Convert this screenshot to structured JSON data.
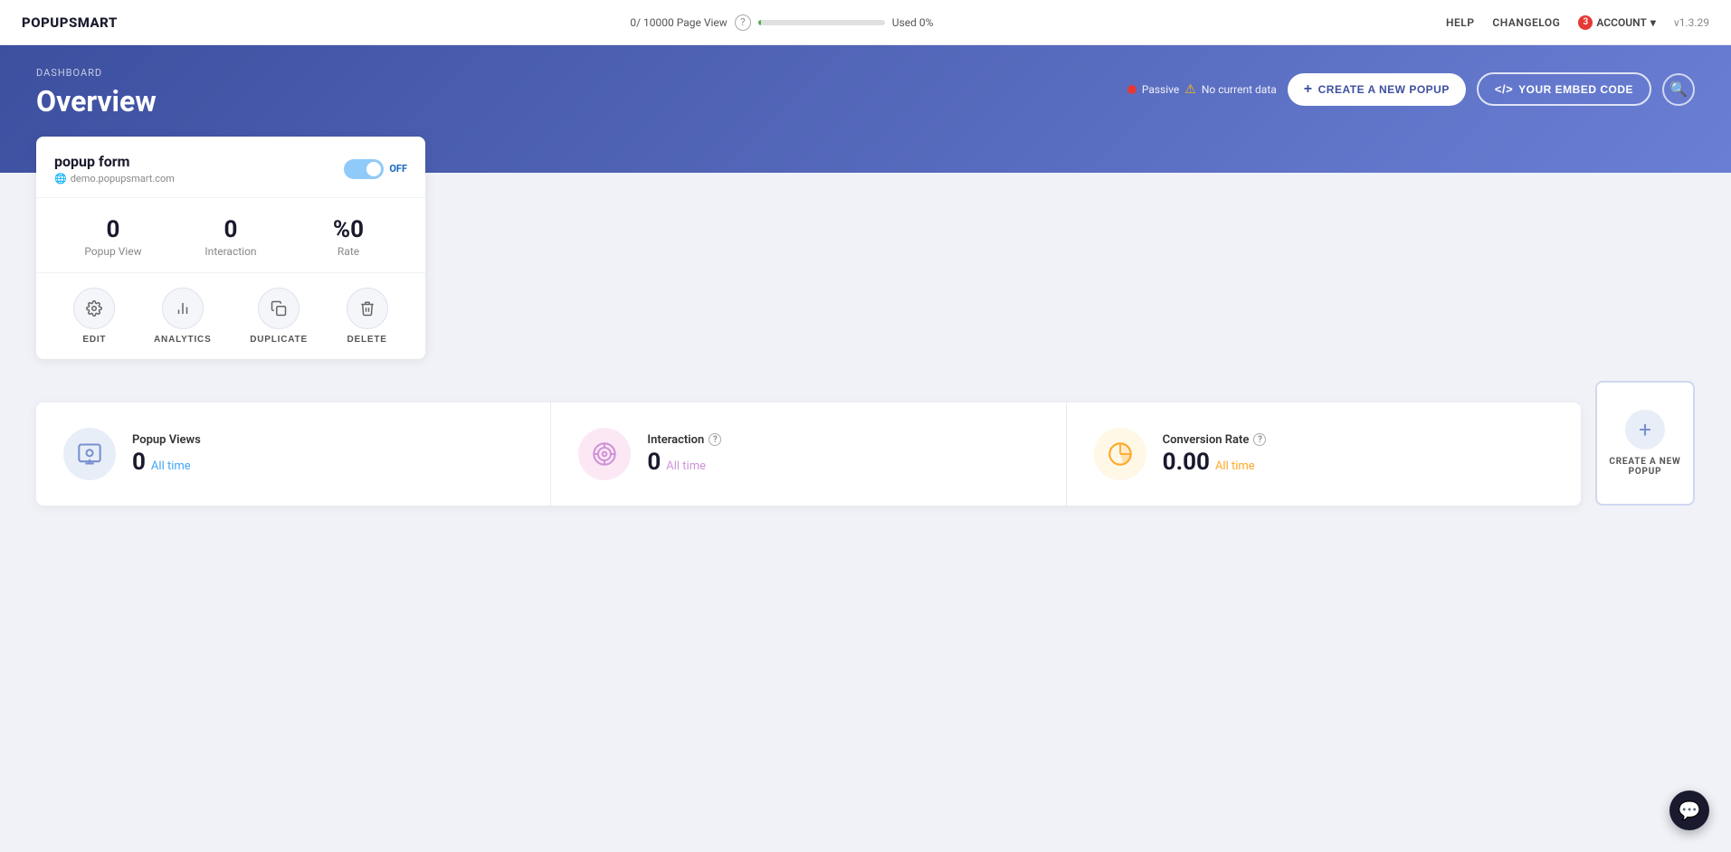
{
  "app": {
    "logo": "POPUPSMART",
    "version": "v1.3.29"
  },
  "topnav": {
    "pageview_label": "0/ 10000 Page View",
    "help_icon": "?",
    "used_label": "Used 0%",
    "help": "HELP",
    "changelog": "CHANGELOG",
    "account": "ACCOUNT",
    "account_badge": "3"
  },
  "header": {
    "breadcrumb": "DASHBOARD",
    "title": "Overview",
    "status_text": "Passive",
    "status_warning": "⚠",
    "no_data_text": "No current data",
    "create_btn": "CREATE A NEW POPUP",
    "embed_btn": "YOUR EMBED CODE"
  },
  "popup_card": {
    "name": "popup form",
    "url": "demo.popupsmart.com",
    "toggle_state": "OFF",
    "stats": [
      {
        "value": "0",
        "label": "Popup View"
      },
      {
        "value": "0",
        "label": "Interaction"
      },
      {
        "value": "%0",
        "label": "Rate"
      }
    ],
    "actions": [
      {
        "key": "edit",
        "label": "EDIT",
        "icon": "⚙"
      },
      {
        "key": "analytics",
        "label": "ANALYTICS",
        "icon": "📊"
      },
      {
        "key": "duplicate",
        "label": "DUPLICATE",
        "icon": "⧉"
      },
      {
        "key": "delete",
        "label": "DELETE",
        "icon": "🗑"
      }
    ]
  },
  "bottom_stats": [
    {
      "key": "popup_views",
      "title": "Popup Views",
      "value": "0",
      "suffix": "All time",
      "suffix_color": "blue",
      "icon": "eye",
      "icon_color": "blue"
    },
    {
      "key": "interaction",
      "title": "Interaction",
      "value": "0",
      "suffix": "All time",
      "suffix_color": "pink",
      "icon": "target",
      "icon_color": "pink"
    },
    {
      "key": "conversion_rate",
      "title": "Conversion Rate",
      "value": "0.00",
      "suffix": "All time",
      "suffix_color": "yellow",
      "icon": "pie",
      "icon_color": "yellow"
    }
  ],
  "create_new": {
    "label": "CREATE A NEW POPUP"
  }
}
